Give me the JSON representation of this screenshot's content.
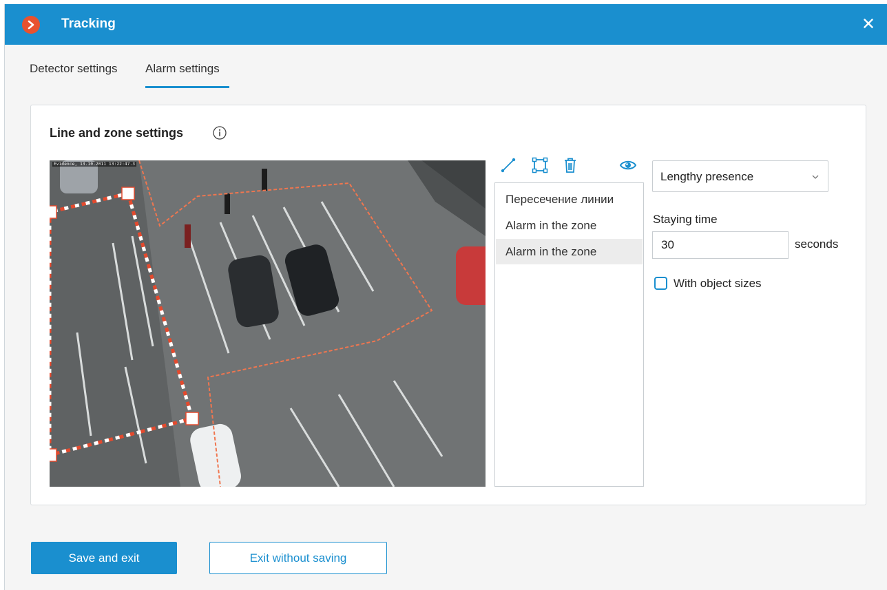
{
  "window": {
    "title": "Tracking",
    "accent_color": "#1a8fcf",
    "logo_color": "#e8522f",
    "logo_icon": "chevron-right-icon",
    "close_icon": "close-icon"
  },
  "tabs": [
    {
      "label": "Detector settings",
      "active": false
    },
    {
      "label": "Alarm settings",
      "active": true
    }
  ],
  "panel": {
    "title": "Line and zone settings",
    "info_icon": "info-icon"
  },
  "video": {
    "osd_text": "Evidence, 13.10.2011 13:22:47.3",
    "line_color": "#e44a2e",
    "zone_color": "#f0764f"
  },
  "toolbar": {
    "icons": [
      "draw-line-icon",
      "draw-zone-icon",
      "delete-icon",
      "visibility-eye-icon"
    ]
  },
  "detector_list": {
    "items": [
      {
        "label": "Пересечение линии",
        "selected": false
      },
      {
        "label": "Alarm in the zone",
        "selected": false
      },
      {
        "label": "Alarm in the zone",
        "selected": true
      }
    ]
  },
  "alarm_settings": {
    "type_select": {
      "value": "Lengthy presence"
    },
    "staying_time": {
      "label": "Staying time",
      "value": "30",
      "unit": "seconds"
    },
    "object_sizes": {
      "label": "With object sizes",
      "checked": false
    }
  },
  "footer": {
    "save_label": "Save and exit",
    "exit_label": "Exit without saving"
  }
}
